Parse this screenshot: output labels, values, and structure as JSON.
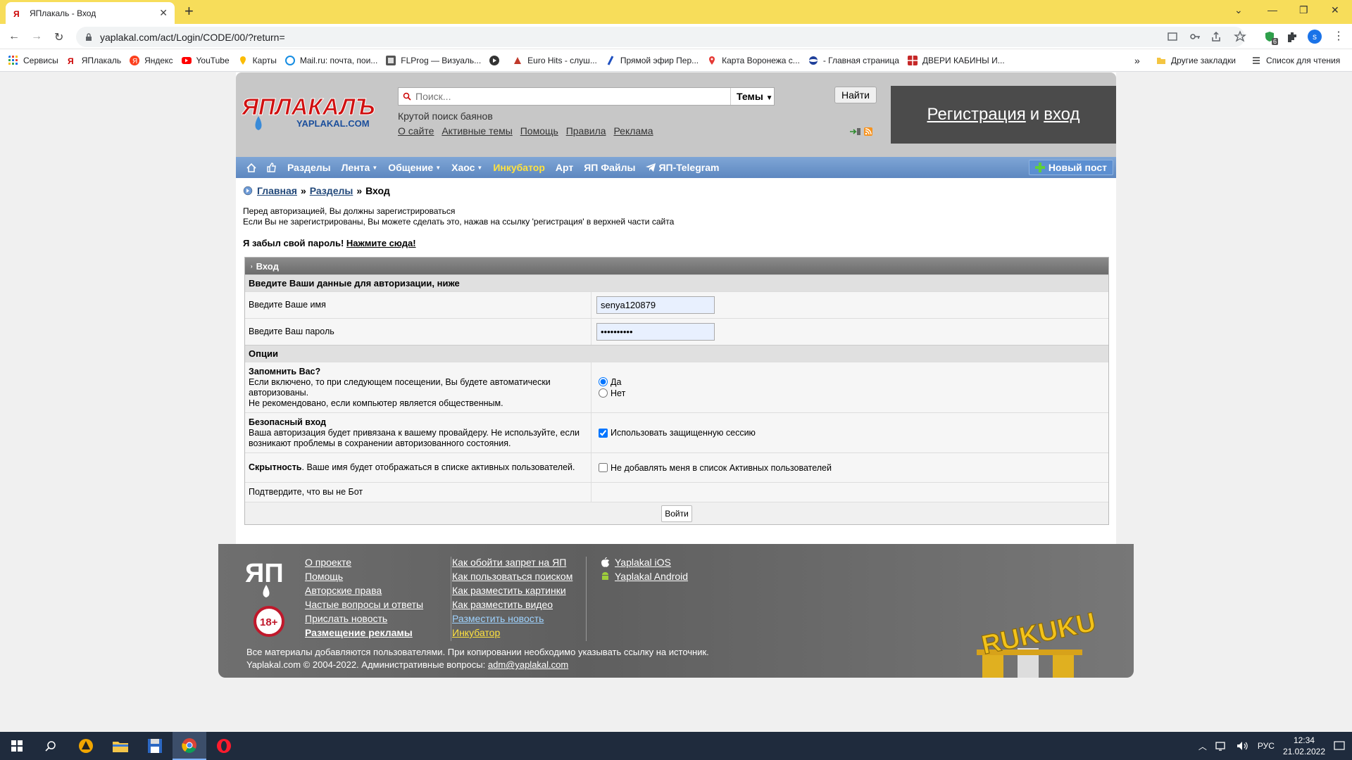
{
  "browser": {
    "tab_title": "ЯПлакаль - Вход",
    "new_tab": "+",
    "url": "yaplakal.com/act/Login/CODE/00/?return=",
    "bookmarks": [
      "Сервисы",
      "ЯПлакаль",
      "Яндекс",
      "YouTube",
      "Карты",
      "Mail.ru: почта, пои...",
      "FLProg — Визуаль...",
      "",
      "Euro Hits - слуш...",
      "Прямой эфир Пер...",
      "Карта Воронежа с...",
      "- Главная страница",
      "ДВЕРИ КАБИНЫ И..."
    ],
    "bookmarks_more": "»",
    "other_bookmarks": "Другие закладки",
    "reading_list": "Список для чтения",
    "profile_initial": "s",
    "ext_badge": "6"
  },
  "header": {
    "logo_text": "ЯПЛАКАЛЪ",
    "logo_sub": "YAPLAKAL.COM",
    "search_placeholder": "Поиск...",
    "topics_label": "Темы",
    "find_button": "Найти",
    "tagline": "Крутой поиск баянов",
    "links": [
      "О сайте",
      "Активные темы",
      "Помощь",
      "Правила",
      "Реклама"
    ],
    "register": "Регистрация",
    "and": "и",
    "login": "вход"
  },
  "menu": {
    "items": [
      "Разделы",
      "Лента",
      "Общение",
      "Хаос",
      "Инкубатор",
      "Арт",
      "ЯП Файлы",
      "ЯП-Telegram"
    ],
    "new_post": "Новый пост"
  },
  "breadcrumb": {
    "home": "Главная",
    "sections": "Разделы",
    "current": "Вход",
    "sep": "»"
  },
  "notice": {
    "line1": "Перед авторизацией, Вы должны зарегистрироваться",
    "line2": "Если Вы не зарегистрированы, Вы можете сделать это, нажав на ссылку 'регистрация' в верхней части сайта"
  },
  "forgot": {
    "text": "Я забыл свой пароль!",
    "link": "Нажмите сюда!"
  },
  "login_form": {
    "title": "Вход",
    "subtitle": "Введите Ваши данные для авторизации, ниже",
    "username_label": "Введите Ваше имя",
    "username_value": "senya120879",
    "password_label": "Введите Ваш пароль",
    "password_value": "••••••••••",
    "options_title": "Опции",
    "remember_title": "Запомнить Вас?",
    "remember_desc": "Если включено, то при следующем посещении, Вы будете автоматически авторизованы.",
    "remember_note": "Не рекомендовано, если компьютер является общественным.",
    "yes": "Да",
    "no": "Нет",
    "secure_title": "Безопасный вход",
    "secure_desc": "Ваша авторизация будет привязана к вашему провайдеру. Не используйте, если возникают проблемы в сохранении авторизованного состояния.",
    "secure_option": "Использовать защищенную сессию",
    "hidden_title": "Скрытность",
    "hidden_desc": ". Ваше имя будет отображаться в списке активных пользователей.",
    "hidden_option": "Не добавлять меня в список Активных пользователей",
    "captcha_label": "Подтвердите, что вы не Бот",
    "submit": "Войти"
  },
  "footer": {
    "col1": [
      "О проекте",
      "Помощь",
      "Авторские права",
      "Частые вопросы и ответы",
      "Прислать новость",
      "Размещение рекламы"
    ],
    "col2": [
      "Как обойти запрет на ЯП",
      "Как пользоваться поиском",
      "Как разместить картинки",
      "Как разместить видео",
      "Разместить новость",
      "Инкубатор"
    ],
    "col3": [
      "Yaplakal iOS",
      "Yaplakal Android"
    ],
    "logo": "ЯП",
    "age": "18+",
    "copy1": "Все материалы добавляются пользователями. При копировании необходимо указывать ссылку на источник.",
    "copy2": "Yaplakal.com © 2004-2022. Административные вопросы:",
    "email": "adm@yaplakal.com",
    "runet": "RUKUKU"
  },
  "taskbar": {
    "lang": "РУС",
    "time": "12:34",
    "date": "21.02.2022"
  },
  "colors": {
    "accent": "#f7dd5a",
    "menu": "#6b93c9",
    "highlight": "#ffe23e",
    "header_bg": "#c7c7c7",
    "reg_bg": "#4b4b4b"
  }
}
